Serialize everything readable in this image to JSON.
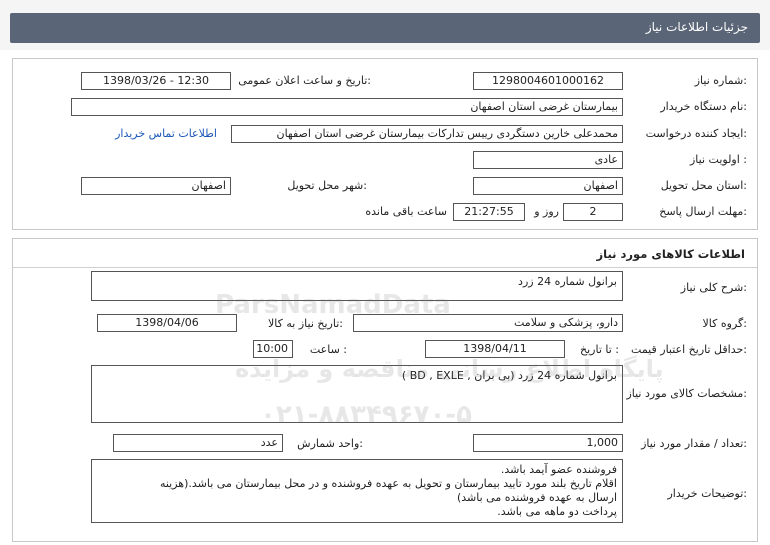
{
  "header": {
    "title": "جزئیات اطلاعات نیاز"
  },
  "info": {
    "need_number_label": "شماره نیاز:",
    "need_number": "1298004601000162",
    "announce_label": "تاریخ و ساعت اعلان عمومی:",
    "announce_value": "1398/03/26 - 12:30",
    "buyer_label": "نام دستگاه خریدار:",
    "buyer_value": "بیمارستان غرضی استان اصفهان",
    "creator_label": "ایجاد کننده درخواست:",
    "creator_value": "محمدعلی خارین دستگردی رییس تدارکات بیمارستان غرضی استان اصفهان",
    "contact_link": "اطلاعات تماس خریدار",
    "priority_label": "اولویت نیاز :",
    "priority_value": "عادی",
    "province_label": "استان محل تحویل:",
    "province_value": "اصفهان",
    "city_label": "شهر محل تحویل:",
    "city_value": "اصفهان",
    "deadline_label": "مهلت ارسال پاسخ:",
    "deadline_days": "2",
    "days_label": "روز و",
    "deadline_time": "21:27:55",
    "remaining_label": "ساعت باقی مانده"
  },
  "goods": {
    "section_title": "اطلاعات کالاهای مورد نیاز",
    "summary_label": "شرح کلی نیاز:",
    "summary_value": "برانول شماره 24 زرد",
    "group_label": "گروه کالا:",
    "group_value": "دارو، پزشکی و سلامت",
    "need_date_label": "تاریخ نیاز به کالا:",
    "need_date_value": "1398/04/06",
    "validity_label": "حداقل تاریخ اعتبار قیمت:",
    "until_date_label": "تا تاریخ :",
    "until_date_value": "1398/04/11",
    "hour_label": "ساعت :",
    "hour_value": "10:00",
    "specs_label": "مشخصات کالای مورد نیاز:",
    "specs_value": "برانول شماره 24 زرد (بی بران , BD , EXLE )",
    "qty_label": "تعداد / مقدار مورد نیاز:",
    "qty_value": "1,000",
    "unit_label": "واحد شمارش:",
    "unit_value": "عدد",
    "notes_label": "توضیحات خریدار:",
    "notes_lines": [
      "فروشنده عضو آیمد باشد.",
      "اقلام تاریخ بلند مورد تایید بیمارستان و تحویل به عهده فروشنده و در محل بیمارستان می باشد.(هزینه",
      "ارسال به عهده فروشنده می باشد)",
      "پرداخت دو ماهه می باشد."
    ]
  },
  "watermark": {
    "brand": "ParsNamadData",
    "line1": "پایگاه اطلاع رسانی مناقصه و مزایده",
    "line2": "۰۲۱-۸۸۳۴۹۶۷۰-۵"
  }
}
